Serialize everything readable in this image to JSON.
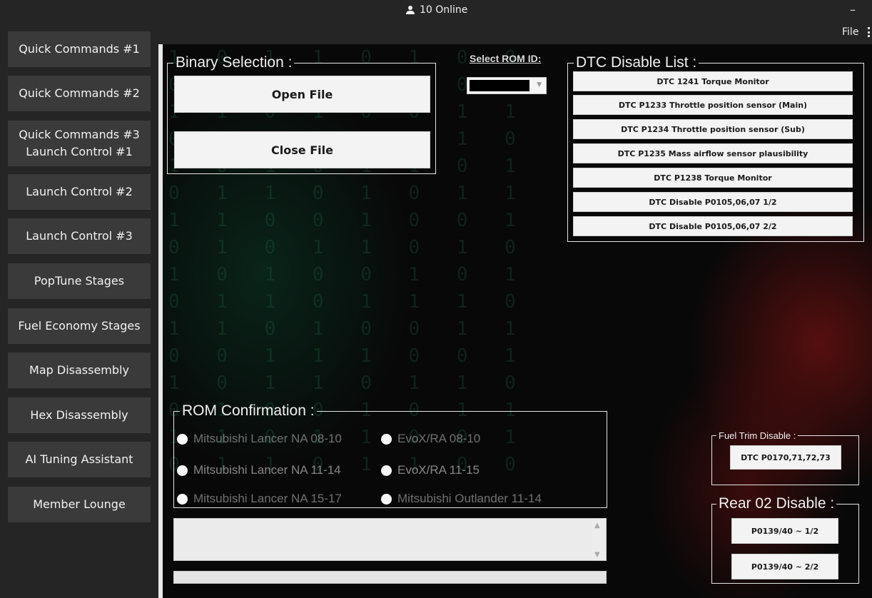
{
  "header": {
    "online_text": "10 Online",
    "minimize_label": "–",
    "file_menu": "File"
  },
  "sidebar": {
    "items": [
      {
        "label": "Quick Commands #1"
      },
      {
        "label": "Quick Commands #2"
      },
      {
        "label": "Quick Commands #3\nLaunch Control #1"
      },
      {
        "label": "Launch Control #2"
      },
      {
        "label": "Launch Control #3"
      },
      {
        "label": "PopTune Stages"
      },
      {
        "label": "Fuel Economy Stages"
      },
      {
        "label": "Map Disassembly"
      },
      {
        "label": "Hex Disassembly"
      },
      {
        "label": "AI Tuning Assistant"
      },
      {
        "label": "Member Lounge"
      }
    ]
  },
  "binary_selection": {
    "title": "Binary Selection :",
    "open_label": "Open File",
    "close_label": "Close File"
  },
  "rom_id": {
    "label": "Select ROM ID:"
  },
  "dtc_disable": {
    "title": "DTC Disable List :",
    "items": [
      "DTC 1241 Torque Monitor",
      "DTC P1233 Throttle position sensor (Main)",
      "DTC P1234 Throttle position sensor (Sub)",
      "DTC P1235  Mass airflow sensor plausibility",
      "DTC P1238 Torque Monitor",
      "DTC Disable P0105,06,07 1/2",
      "DTC Disable P0105,06,07 2/2"
    ]
  },
  "rom_confirmation": {
    "title": "ROM Confirmation :",
    "options": [
      "Mitsubishi Lancer NA 08-10",
      "EvoX/RA 08-10",
      "Mitsubishi Lancer NA 11-14",
      "EvoX/RA 11-15",
      "Mitsubishi Lancer NA 15-17",
      "Mitsubishi Outlander 11-14"
    ]
  },
  "fuel_trim": {
    "title": "Fuel Trim Disable :",
    "button": "DTC P0170,71,72,73"
  },
  "rear_o2": {
    "title": "Rear 02 Disable :",
    "buttons": [
      "P0139/40 ~ 1/2",
      "P0139/40 ~ 2/2"
    ]
  },
  "progress": {
    "value": 0
  },
  "colors": {
    "sidebar_button": "#3a3a3a",
    "background": "#252525",
    "progress_fill": "#06b025"
  }
}
